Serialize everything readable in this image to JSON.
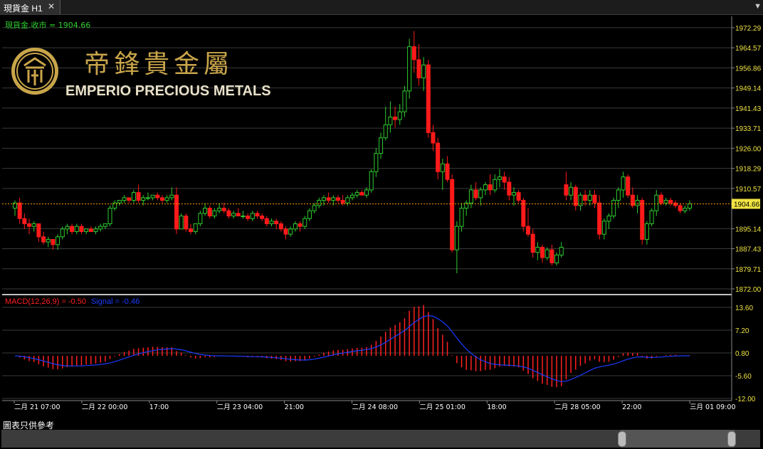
{
  "tab": {
    "label": "現貨金 H1",
    "close": "✕",
    "menu": "▼"
  },
  "price_label": "現貨金.收市 = 1904.66",
  "current_price": "1904.66",
  "brand": {
    "chinese": "帝鋒貴金屬",
    "english": "EMPERIO PRECIOUS METALS"
  },
  "macd_label": "MACD(12,26,9) = -0.50",
  "signal_label": "Signal = -0.46",
  "disclaimer": "圖表只供參考",
  "colors": {
    "up": "#2ecc2e",
    "down": "#ff1a1a",
    "price_axis": "#f0e442",
    "macd_hist": "#ff2020",
    "signal": "#1a3cff",
    "last_price_line": "#ff9900"
  },
  "chart_data": [
    {
      "type": "candlestick",
      "title": "現貨金 H1",
      "y_ticks": [
        "1972.29",
        "1964.57",
        "1956.86",
        "1949.14",
        "1941.43",
        "1933.71",
        "1926.00",
        "1918.29",
        "1910.57",
        "1904.66",
        "1895.14",
        "1887.43",
        "1879.71",
        "1872.00"
      ],
      "x_ticks": [
        "二月 21 07:00",
        "二月 22 00:00",
        "17:00",
        "二月 23 04:00",
        "21:00",
        "二月 24 08:00",
        "二月 25 01:00",
        "18:00",
        "二月 28 05:00",
        "22:00",
        "三月 01 09:00"
      ],
      "ylim": [
        1872.0,
        1975.0
      ],
      "candles": [
        [
          1903,
          1906,
          1900,
          1905
        ],
        [
          1905,
          1907,
          1897,
          1899
        ],
        [
          1899,
          1901,
          1895,
          1897
        ],
        [
          1897,
          1899,
          1893,
          1896
        ],
        [
          1896,
          1898,
          1894,
          1897
        ],
        [
          1897,
          1897,
          1890,
          1892
        ],
        [
          1892,
          1894,
          1889,
          1890
        ],
        [
          1890,
          1892,
          1888,
          1891
        ],
        [
          1891,
          1891,
          1887,
          1889
        ],
        [
          1889,
          1893,
          1887,
          1892
        ],
        [
          1892,
          1896,
          1891,
          1895
        ],
        [
          1895,
          1897,
          1893,
          1896
        ],
        [
          1896,
          1897,
          1893,
          1894
        ],
        [
          1894,
          1897,
          1893,
          1896
        ],
        [
          1896,
          1897,
          1893,
          1894
        ],
        [
          1894,
          1895,
          1893,
          1895
        ],
        [
          1895,
          1896,
          1894,
          1894
        ],
        [
          1894,
          1896,
          1893,
          1895
        ],
        [
          1895,
          1897,
          1894,
          1896
        ],
        [
          1896,
          1897,
          1895,
          1897
        ],
        [
          1897,
          1904,
          1896,
          1903
        ],
        [
          1903,
          1906,
          1902,
          1905
        ],
        [
          1905,
          1906,
          1904,
          1906
        ],
        [
          1906,
          1908,
          1905,
          1907
        ],
        [
          1907,
          1907,
          1905,
          1906
        ],
        [
          1906,
          1910,
          1905,
          1909
        ],
        [
          1909,
          1912,
          1905,
          1906
        ],
        [
          1906,
          1908,
          1904,
          1907
        ],
        [
          1907,
          1909,
          1906,
          1907
        ],
        [
          1907,
          1908,
          1906,
          1908
        ],
        [
          1908,
          1909,
          1906,
          1907
        ],
        [
          1907,
          1908,
          1905,
          1906
        ],
        [
          1906,
          1908,
          1905,
          1907
        ],
        [
          1907,
          1911,
          1906,
          1908
        ],
        [
          1908,
          1911,
          1893,
          1895
        ],
        [
          1895,
          1901,
          1895,
          1900
        ],
        [
          1900,
          1901,
          1894,
          1895
        ],
        [
          1895,
          1897,
          1893,
          1894
        ],
        [
          1894,
          1897,
          1893,
          1897
        ],
        [
          1897,
          1902,
          1896,
          1901
        ],
        [
          1901,
          1905,
          1900,
          1903
        ],
        [
          1903,
          1904,
          1899,
          1900
        ],
        [
          1900,
          1903,
          1899,
          1902
        ],
        [
          1902,
          1905,
          1901,
          1903
        ],
        [
          1903,
          1905,
          1901,
          1902
        ],
        [
          1902,
          1903,
          1899,
          1900
        ],
        [
          1900,
          1902,
          1899,
          1901
        ],
        [
          1901,
          1903,
          1900,
          1900
        ],
        [
          1900,
          1902,
          1899,
          1900
        ],
        [
          1900,
          1901,
          1898,
          1899
        ],
        [
          1899,
          1902,
          1898,
          1901
        ],
        [
          1901,
          1902,
          1899,
          1900
        ],
        [
          1900,
          1901,
          1898,
          1899
        ],
        [
          1899,
          1900,
          1896,
          1897
        ],
        [
          1897,
          1899,
          1896,
          1898
        ],
        [
          1898,
          1899,
          1895,
          1897
        ],
        [
          1897,
          1898,
          1894,
          1895
        ],
        [
          1895,
          1896,
          1891,
          1893
        ],
        [
          1893,
          1896,
          1892,
          1895
        ],
        [
          1895,
          1898,
          1894,
          1897
        ],
        [
          1897,
          1898,
          1894,
          1896
        ],
        [
          1896,
          1900,
          1895,
          1899
        ],
        [
          1899,
          1903,
          1898,
          1902
        ],
        [
          1902,
          1905,
          1901,
          1904
        ],
        [
          1904,
          1907,
          1903,
          1906
        ],
        [
          1906,
          1908,
          1904,
          1907
        ],
        [
          1907,
          1909,
          1905,
          1906
        ],
        [
          1906,
          1908,
          1904,
          1907
        ],
        [
          1907,
          1908,
          1905,
          1906
        ],
        [
          1906,
          1908,
          1904,
          1905
        ],
        [
          1905,
          1908,
          1904,
          1907
        ],
        [
          1907,
          1909,
          1906,
          1908
        ],
        [
          1908,
          1910,
          1907,
          1909
        ],
        [
          1909,
          1910,
          1908,
          1908
        ],
        [
          1908,
          1911,
          1907,
          1910
        ],
        [
          1910,
          1918,
          1909,
          1917
        ],
        [
          1917,
          1926,
          1915,
          1924
        ],
        [
          1924,
          1932,
          1922,
          1930
        ],
        [
          1930,
          1942,
          1929,
          1935
        ],
        [
          1935,
          1944,
          1932,
          1938
        ],
        [
          1938,
          1942,
          1934,
          1937
        ],
        [
          1937,
          1943,
          1935,
          1940
        ],
        [
          1940,
          1950,
          1938,
          1948
        ],
        [
          1948,
          1968,
          1945,
          1965
        ],
        [
          1965,
          1971,
          1955,
          1960
        ],
        [
          1960,
          1966,
          1950,
          1953
        ],
        [
          1953,
          1961,
          1948,
          1958
        ],
        [
          1958,
          1960,
          1930,
          1932
        ],
        [
          1932,
          1935,
          1925,
          1928
        ],
        [
          1928,
          1930,
          1914,
          1917
        ],
        [
          1917,
          1922,
          1910,
          1920
        ],
        [
          1920,
          1923,
          1913,
          1914
        ],
        [
          1914,
          1916,
          1886,
          1887
        ],
        [
          1887,
          1898,
          1878,
          1896
        ],
        [
          1896,
          1905,
          1894,
          1903
        ],
        [
          1903,
          1906,
          1900,
          1905
        ],
        [
          1905,
          1912,
          1903,
          1910
        ],
        [
          1910,
          1913,
          1906,
          1907
        ],
        [
          1907,
          1911,
          1904,
          1910
        ],
        [
          1910,
          1913,
          1908,
          1912
        ],
        [
          1912,
          1916,
          1908,
          1910
        ],
        [
          1910,
          1916,
          1909,
          1914
        ],
        [
          1914,
          1918,
          1911,
          1915
        ],
        [
          1915,
          1917,
          1910,
          1913
        ],
        [
          1913,
          1915,
          1906,
          1908
        ],
        [
          1908,
          1911,
          1904,
          1909
        ],
        [
          1909,
          1910,
          1905,
          1906
        ],
        [
          1906,
          1907,
          1894,
          1896
        ],
        [
          1896,
          1903,
          1892,
          1893
        ],
        [
          1893,
          1895,
          1884,
          1886
        ],
        [
          1886,
          1890,
          1883,
          1888
        ],
        [
          1888,
          1889,
          1882,
          1884
        ],
        [
          1884,
          1888,
          1883,
          1887
        ],
        [
          1887,
          1889,
          1881,
          1882
        ],
        [
          1882,
          1886,
          1881,
          1885
        ],
        [
          1885,
          1890,
          1884,
          1888
        ],
        [
          1912,
          1917,
          1906,
          1908
        ],
        [
          1908,
          1913,
          1906,
          1911
        ],
        [
          1911,
          1912,
          1902,
          1904
        ],
        [
          1904,
          1909,
          1902,
          1908
        ],
        [
          1908,
          1910,
          1904,
          1906
        ],
        [
          1906,
          1910,
          1904,
          1908
        ],
        [
          1908,
          1910,
          1903,
          1905
        ],
        [
          1905,
          1908,
          1891,
          1893
        ],
        [
          1893,
          1899,
          1891,
          1898
        ],
        [
          1898,
          1901,
          1895,
          1900
        ],
        [
          1900,
          1907,
          1899,
          1906
        ],
        [
          1906,
          1911,
          1903,
          1910
        ],
        [
          1910,
          1917,
          1907,
          1915
        ],
        [
          1915,
          1916,
          1907,
          1908
        ],
        [
          1908,
          1911,
          1903,
          1904
        ],
        [
          1904,
          1908,
          1901,
          1906
        ],
        [
          1906,
          1907,
          1889,
          1891
        ],
        [
          1891,
          1898,
          1889,
          1897
        ],
        [
          1897,
          1903,
          1896,
          1902
        ],
        [
          1902,
          1910,
          1900,
          1908
        ],
        [
          1908,
          1909,
          1904,
          1905
        ],
        [
          1905,
          1907,
          1904,
          1906
        ],
        [
          1906,
          1907,
          1904,
          1905
        ],
        [
          1905,
          1906,
          1903,
          1904
        ],
        [
          1904,
          1905,
          1901,
          1902
        ],
        [
          1902,
          1904,
          1901,
          1903
        ],
        [
          1903,
          1906,
          1902,
          1904.66
        ]
      ]
    },
    {
      "type": "bar",
      "title": "MACD(12,26,9)",
      "y_ticks": [
        "13.60",
        "7.20",
        "0.80",
        "-5.60",
        "-12.00"
      ],
      "ylim": [
        -12.0,
        16.0
      ]
    }
  ]
}
